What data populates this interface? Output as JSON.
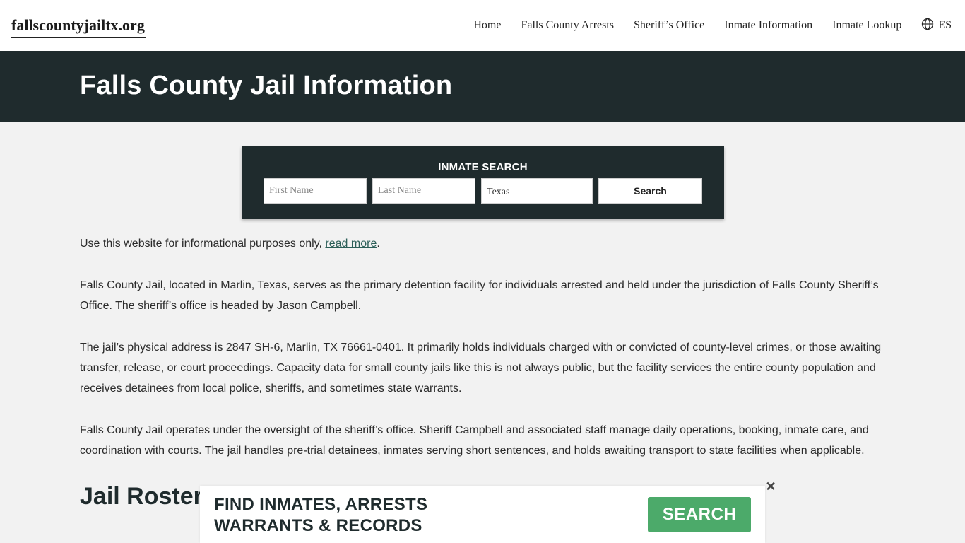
{
  "header": {
    "logo": "fallscountyjailtx.org",
    "nav": [
      {
        "label": "Home"
      },
      {
        "label": "Falls County Arrests"
      },
      {
        "label": "Sheriff’s Office"
      },
      {
        "label": "Inmate Information"
      },
      {
        "label": "Inmate Lookup"
      }
    ],
    "language": {
      "icon": "globe-icon",
      "label": "ES"
    }
  },
  "banner": {
    "title": "Falls County Jail Information"
  },
  "search": {
    "title": "INMATE SEARCH",
    "first_name_placeholder": "First Name",
    "last_name_placeholder": "Last Name",
    "state_value": "Texas",
    "button_label": "Search"
  },
  "content": {
    "disclaimer_text": "Use this website for informational purposes only, ",
    "disclaimer_link": "read more",
    "disclaimer_end": ".",
    "paragraphs": [
      "Falls County Jail, located in Marlin, Texas, serves as the primary detention facility for individuals arrested and held under the jurisdiction of Falls County Sheriff’s Office. The sheriff’s office is headed by Jason Campbell.",
      "The jail’s physical address is 2847 SH-6, Marlin, TX 76661-0401. It primarily holds individuals charged with or convicted of county-level crimes, or those awaiting transfer, release, or court proceedings. Capacity data for small county jails like this is not always public, but the facility services the entire county population and receives detainees from local police, sheriffs, and sometimes state warrants.",
      "Falls County Jail operates under the oversight of the sheriff’s office. Sheriff Campbell and associated staff manage daily operations, booking, inmate care, and coordination with courts. The jail handles pre-trial detainees, inmates serving short sentences, and holds awaiting transport to state facilities when applicable."
    ],
    "heading": "Jail Roster"
  },
  "ad": {
    "line1": "FIND INMATES, ARRESTS",
    "line2": "WARRANTS & RECORDS",
    "button_label": "SEARCH",
    "close_symbol": "✕"
  },
  "colors": {
    "banner_bg": "#1f2b2d",
    "link": "#2c5f58",
    "ad_button": "#4caa6a",
    "page_bg": "#f2f2f2"
  }
}
